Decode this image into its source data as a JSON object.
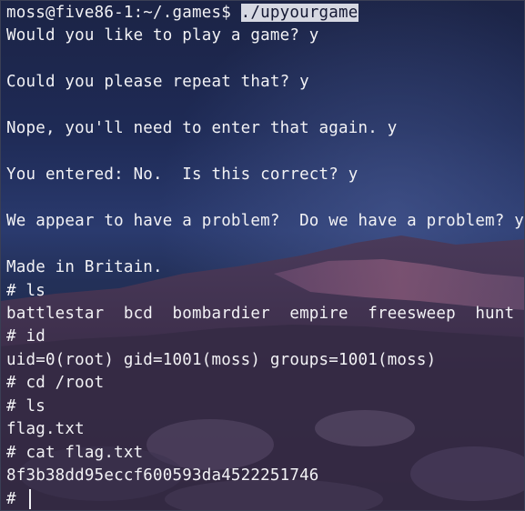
{
  "terminal": {
    "prompt": "moss@five86-1:~/.games$ ",
    "command": "./upyourgame",
    "lines": [
      "Would you like to play a game? y",
      "Could you please repeat that? y",
      "Nope, you'll need to enter that again. y",
      "You entered: No.  Is this correct? y",
      "We appear to have a problem?  Do we have a problem? y",
      "Made in Britain.",
      "# ls",
      "battlestar  bcd  bombardier  empire  freesweep  hunt",
      "# id",
      "uid=0(root) gid=1001(moss) groups=1001(moss)",
      "# cd /root",
      "# ls",
      "flag.txt",
      "# cat flag.txt",
      "8f3b38dd95eccf600593da4522251746"
    ],
    "final_prompt": "# "
  }
}
